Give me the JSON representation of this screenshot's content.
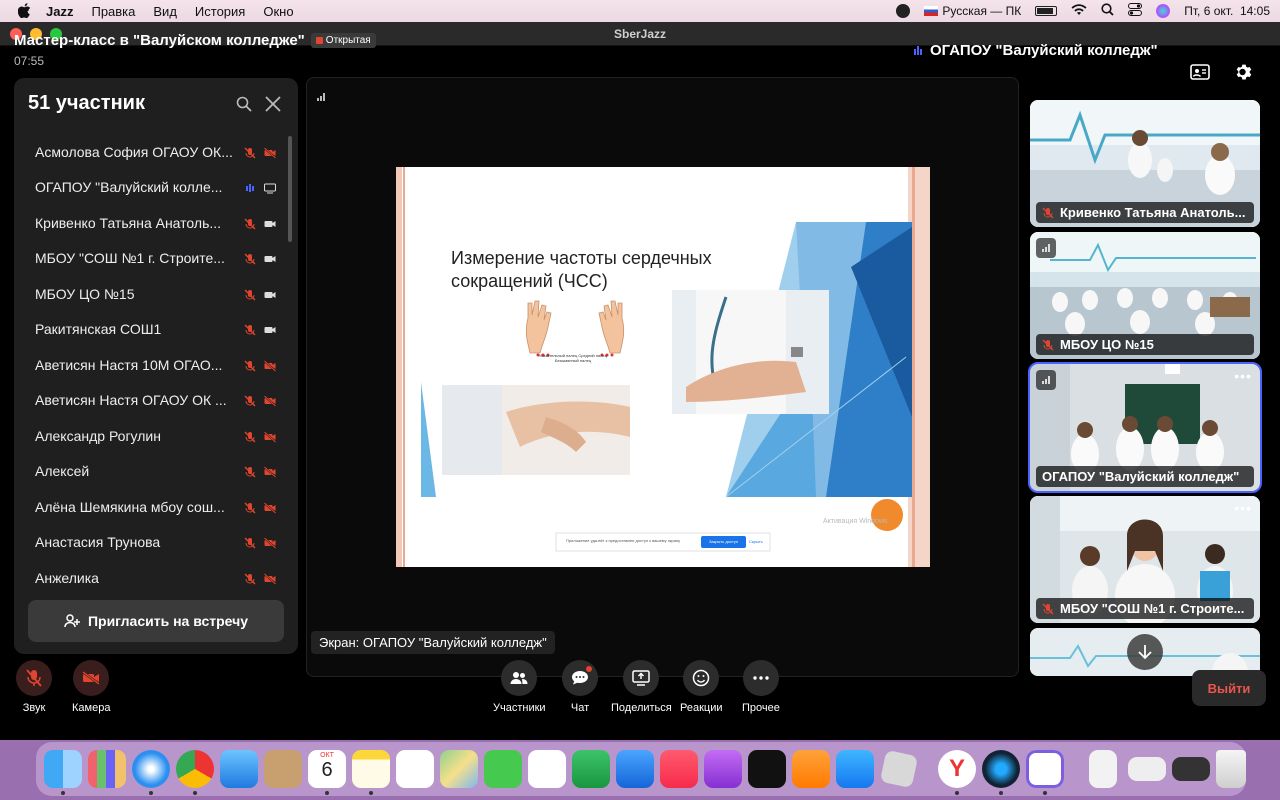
{
  "menubar": {
    "app_name": "Jazz",
    "items": [
      "Правка",
      "Вид",
      "История",
      "Окно"
    ],
    "input_source": "Русская — ПК",
    "datetime": "Пт, 6 окт.  14:05"
  },
  "window": {
    "title": "SberJazz"
  },
  "meeting": {
    "title": "Мастер-класс в \"Валуйском колледже\"",
    "badge": "Открытая",
    "timer": "07:55",
    "active_speaker": "ОГАПОУ \"Валуйский колледж\""
  },
  "participants": {
    "header": "51 участник",
    "list": [
      {
        "name": "Асмолова София ОГАОУ ОК...",
        "mic": "off",
        "cam": "off"
      },
      {
        "name": "ОГАПОУ \"Валуйский колле...",
        "mic": "speaking",
        "cam": "screen"
      },
      {
        "name": "Кривенко Татьяна Анатоль...",
        "mic": "off",
        "cam": "on"
      },
      {
        "name": "МБОУ \"СОШ №1 г. Строите...",
        "mic": "off",
        "cam": "on"
      },
      {
        "name": "МБОУ ЦО №15",
        "mic": "off",
        "cam": "on"
      },
      {
        "name": "Ракитянская СОШ1",
        "mic": "off",
        "cam": "on"
      },
      {
        "name": "Аветисян Настя 10М ОГАО...",
        "mic": "off",
        "cam": "off"
      },
      {
        "name": "Аветисян Настя ОГАОУ ОК ...",
        "mic": "off",
        "cam": "off"
      },
      {
        "name": "Александр Рогулин",
        "mic": "off",
        "cam": "off"
      },
      {
        "name": "Алексей",
        "mic": "off",
        "cam": "off"
      },
      {
        "name": "Алёна Шемякина мбоу сош...",
        "mic": "off",
        "cam": "off"
      },
      {
        "name": "Анастасия Трунова",
        "mic": "off",
        "cam": "off"
      },
      {
        "name": "Анжелика",
        "mic": "off",
        "cam": "off"
      }
    ],
    "invite_label": "Пригласить на встречу"
  },
  "slide": {
    "title": "Измерение частоты сердечных сокращений (ЧСС)",
    "hand_caption": "Указательный палец Средний палец Безымянный палец",
    "banner_text": "Приложение уда-вёт к предоставлен доступ к вашему экрану",
    "banner_button": "Закрыть доступ",
    "banner_link": "Скрыть",
    "watermark": "Активация Windows"
  },
  "screen_share_label": "Экран: ОГАПОУ \"Валуйский колледж\"",
  "tiles": [
    {
      "label": "Кривенко Татьяна Анатоль...",
      "muted": true
    },
    {
      "label": "МБОУ ЦО №15",
      "muted": true
    },
    {
      "label": "ОГАПОУ \"Валуйский колледж\"",
      "muted": false,
      "active": true
    },
    {
      "label": "МБОУ \"СОШ №1 г. Строите...",
      "muted": true
    }
  ],
  "toolbar": {
    "sound": "Звук",
    "camera": "Камера",
    "participants": "Участники",
    "chat": "Чат",
    "share": "Поделиться",
    "reactions": "Реакции",
    "more": "Прочее",
    "leave": "Выйти"
  },
  "dock": {
    "calendar_month": "ОКТ",
    "calendar_day": "6"
  },
  "colors": {
    "accent": "#4b62ff",
    "leave": "#e8564d",
    "mic_off": "#e0452f"
  }
}
